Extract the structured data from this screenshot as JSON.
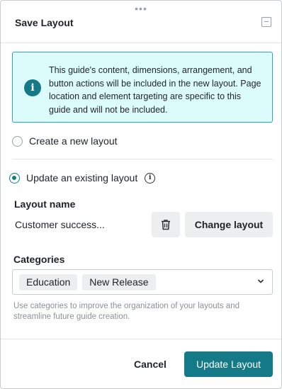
{
  "dialog": {
    "title": "Save Layout"
  },
  "info": {
    "text": "This guide's content, dimensions, arrangement, and button actions will be included in the new layout. Page location and element targeting are specific to this guide and will not be included."
  },
  "options": {
    "create_label": "Create a new layout",
    "update_label": "Update an existing layout",
    "selected": "update"
  },
  "layout_name": {
    "label": "Layout name",
    "value": "Customer success...",
    "change_button": "Change layout"
  },
  "categories": {
    "label": "Categories",
    "chips": [
      "Education",
      "New Release"
    ],
    "help": "Use categories to improve the organization of your layouts and streamline future guide creation."
  },
  "footer": {
    "cancel": "Cancel",
    "submit": "Update Layout"
  },
  "colors": {
    "accent": "#147a87",
    "info_bg": "#dcfbfb",
    "info_border": "#2aa8b3"
  },
  "icons": {
    "drag": "drag-handle-icon",
    "minimize": "minimize-icon",
    "info": "info-icon",
    "help": "help-icon",
    "trash": "trash-icon",
    "chevron": "chevron-down-icon"
  }
}
